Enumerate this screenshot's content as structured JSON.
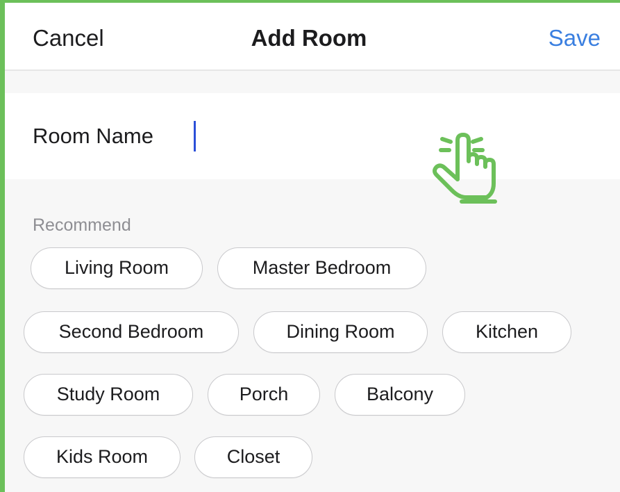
{
  "nav": {
    "cancel_label": "Cancel",
    "title": "Add Room",
    "save_label": "Save"
  },
  "room_name": {
    "label": "Room Name",
    "value": ""
  },
  "recommend": {
    "label": "Recommend",
    "chips": [
      "Living Room",
      "Master Bedroom",
      "Second Bedroom",
      "Dining Room",
      "Kitchen",
      "Study Room",
      "Porch",
      "Balcony",
      "Kids Room",
      "Closet"
    ]
  },
  "icons": {
    "tap_hint": "tap-hand-icon"
  },
  "colors": {
    "accent_blue": "#3a7fe0",
    "highlight_green": "#6cc05a",
    "caret_blue": "#2b4fd8"
  }
}
